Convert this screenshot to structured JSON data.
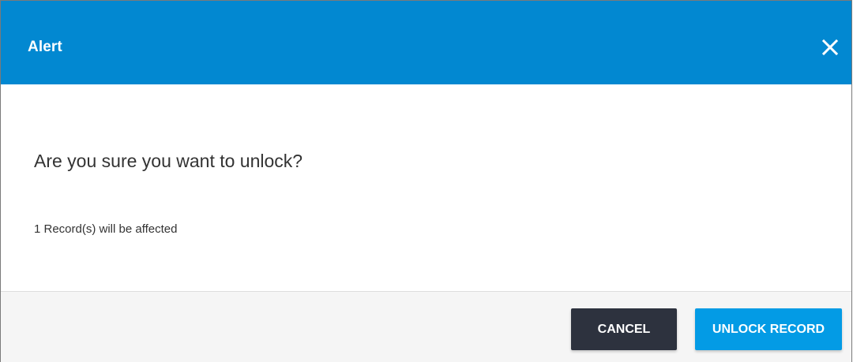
{
  "dialog": {
    "title": "Alert",
    "close_icon": "close-icon",
    "message": "Are you sure you want to unlock?",
    "detail": "1 Record(s) will be affected"
  },
  "footer": {
    "cancel_label": "CANCEL",
    "confirm_label": "UNLOCK RECORD"
  },
  "colors": {
    "header_bg": "#0288d1",
    "cancel_bg": "#2d323e",
    "confirm_bg": "#039be5",
    "footer_bg": "#f5f5f5"
  }
}
